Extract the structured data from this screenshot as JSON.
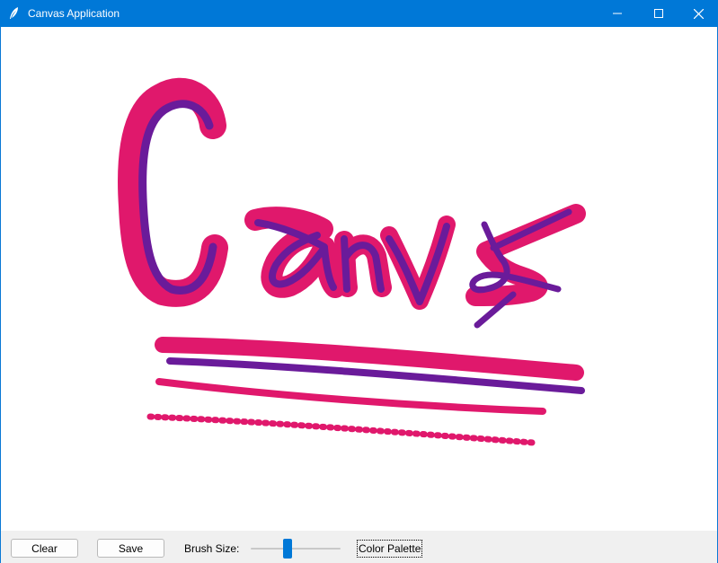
{
  "window": {
    "title": "Canvas Application",
    "icon": "feather-icon",
    "controls": [
      "minimize-icon",
      "maximize-icon",
      "close-icon"
    ]
  },
  "canvas": {
    "background": "#ffffff",
    "stroke_colors": {
      "pink": "#e0186c",
      "purple": "#6a1b9a"
    },
    "drawn_text": "Canvas"
  },
  "toolbar": {
    "clear_label": "Clear",
    "save_label": "Save",
    "brush_size_label": "Brush Size:",
    "brush_size_fraction": 0.4,
    "color_palette_label": "Color Palette"
  },
  "colors": {
    "titlebar": "#0078d7",
    "toolbar": "#f0f0f0",
    "slider_thumb": "#0078d7"
  }
}
